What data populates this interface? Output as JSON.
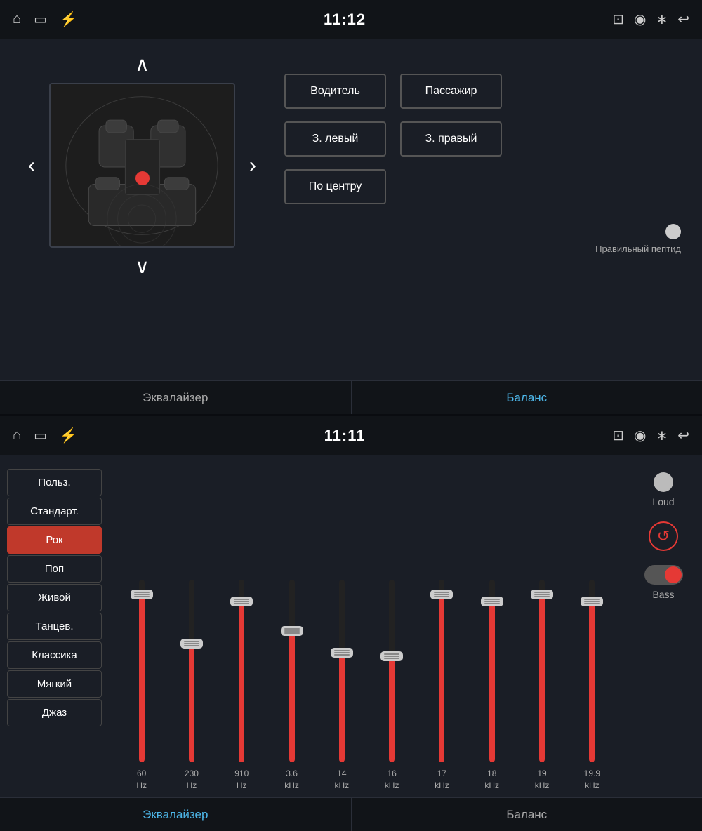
{
  "top": {
    "statusBar": {
      "time": "11:12",
      "leftIcons": [
        "home-icon",
        "screen-icon",
        "usb-icon"
      ],
      "rightIcons": [
        "cast-icon",
        "location-icon",
        "bluetooth-icon",
        "back-icon"
      ]
    },
    "tabs": [
      {
        "label": "Эквалайзер",
        "active": false
      },
      {
        "label": "Баланс",
        "active": true
      }
    ],
    "buttons": [
      {
        "label": "Водитель"
      },
      {
        "label": "Пассажир"
      },
      {
        "label": "З. левый"
      },
      {
        "label": "З. правый"
      },
      {
        "label": "По центру"
      }
    ],
    "peptide": {
      "label": "Правильный пептид"
    }
  },
  "bottom": {
    "statusBar": {
      "time": "11:11",
      "leftIcons": [
        "home-icon",
        "screen-icon",
        "usb-icon"
      ],
      "rightIcons": [
        "cast-icon",
        "location-icon",
        "bluetooth-icon",
        "back-icon"
      ]
    },
    "tabs": [
      {
        "label": "Эквалайзер",
        "active": true
      },
      {
        "label": "Баланс",
        "active": false
      }
    ],
    "presets": [
      {
        "label": "Польз.",
        "active": false
      },
      {
        "label": "Стандарт.",
        "active": false
      },
      {
        "label": "Рок",
        "active": true
      },
      {
        "label": "Поп",
        "active": false
      },
      {
        "label": "Живой",
        "active": false
      },
      {
        "label": "Танцев.",
        "active": false
      },
      {
        "label": "Классика",
        "active": false
      },
      {
        "label": "Мягкий",
        "active": false
      },
      {
        "label": "Джаз",
        "active": false
      }
    ],
    "sliders": [
      {
        "freq": "60",
        "unit": "Hz",
        "fillPct": 92,
        "thumbPct": 92
      },
      {
        "freq": "230",
        "unit": "Hz",
        "fillPct": 65,
        "thumbPct": 65
      },
      {
        "freq": "910",
        "unit": "Hz",
        "fillPct": 88,
        "thumbPct": 88
      },
      {
        "freq": "3.6",
        "unit": "kHz",
        "fillPct": 72,
        "thumbPct": 72
      },
      {
        "freq": "14",
        "unit": "kHz",
        "fillPct": 60,
        "thumbPct": 60
      },
      {
        "freq": "16",
        "unit": "kHz",
        "fillPct": 58,
        "thumbPct": 58
      },
      {
        "freq": "17",
        "unit": "kHz",
        "fillPct": 92,
        "thumbPct": 92
      },
      {
        "freq": "18",
        "unit": "kHz",
        "fillPct": 88,
        "thumbPct": 88
      },
      {
        "freq": "19",
        "unit": "kHz",
        "fillPct": 92,
        "thumbPct": 92
      },
      {
        "freq": "19.9",
        "unit": "kHz",
        "fillPct": 88,
        "thumbPct": 88
      }
    ],
    "controls": {
      "loudLabel": "Loud",
      "bassLabel": "Bass",
      "resetLabel": "↺"
    }
  }
}
